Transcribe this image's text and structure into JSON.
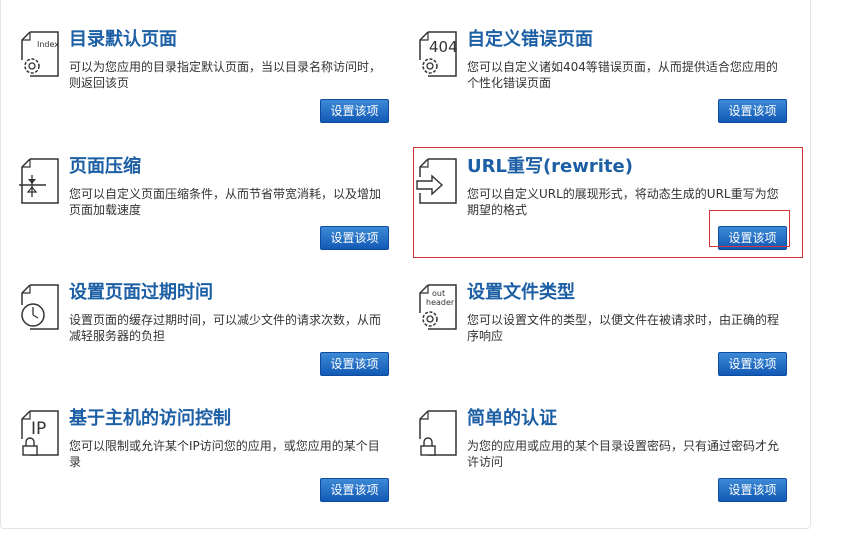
{
  "cards": [
    {
      "icon_name": "index-doc-gear-icon",
      "icon_text": "Index",
      "title": "目录默认页面",
      "desc": "可以为您应用的目录指定默认页面，当以目录名称访问时，则返回该页",
      "button": "设置该项"
    },
    {
      "icon_name": "404-doc-gear-icon",
      "icon_text": "404",
      "title": "自定义错误页面",
      "desc": "您可以自定义诸如404等错误页面，从而提供适合您应用的个性化错误页面",
      "button": "设置该项"
    },
    {
      "icon_name": "compress-doc-icon",
      "title": "页面压缩",
      "desc": "您可以自定义页面压缩条件，从而节省带宽消耗，以及增加页面加载速度",
      "button": "设置该项"
    },
    {
      "icon_name": "rewrite-doc-arrow-icon",
      "title": "URL重写(rewrite)",
      "desc": "您可以自定义URL的展现形式，将动态生成的URL重写为您期望的格式",
      "button": "设置该项"
    },
    {
      "icon_name": "expire-doc-clock-icon",
      "title": "设置页面过期时间",
      "desc": "设置页面的缓存过期时间，可以减少文件的请求次数，从而减轻服务器的负担",
      "button": "设置该项"
    },
    {
      "icon_name": "header-doc-gear-icon",
      "icon_text_1": "out",
      "icon_text_2": "header",
      "title": "设置文件类型",
      "desc": "您可以设置文件的类型，以便文件在被请求时，由正确的程序响应",
      "button": "设置该项"
    },
    {
      "icon_name": "ip-doc-lock-icon",
      "icon_text": "IP",
      "title": "基于主机的访问控制",
      "desc": "您可以限制或允许某个IP访问您的应用，或您应用的某个目录",
      "button": "设置该项"
    },
    {
      "icon_name": "auth-doc-lock-icon",
      "title": "简单的认证",
      "desc": "为您的应用或应用的某个目录设置密码，只有通过密码才允许访问",
      "button": "设置该项"
    }
  ],
  "colors": {
    "title": "#1d5fa5",
    "button_top": "#3d8ad6",
    "button_bottom": "#1259b5",
    "highlight": "#d9323a"
  }
}
